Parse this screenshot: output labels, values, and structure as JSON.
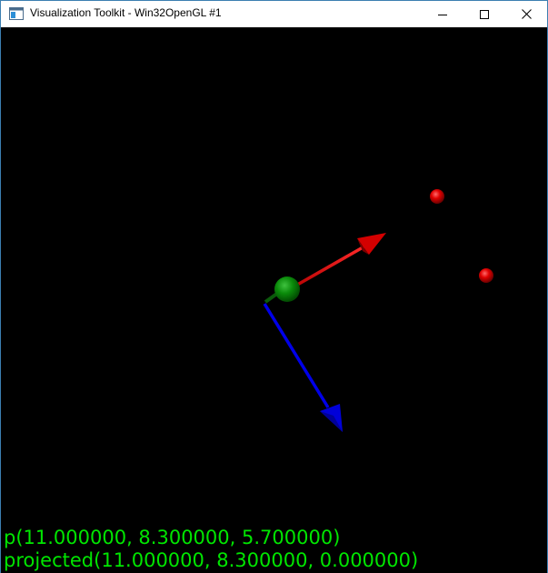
{
  "window": {
    "title": "Visualization Toolkit - Win32OpenGL #1",
    "icon": "vtk-window-icon",
    "controls": {
      "minimize_icon": "minimize-icon",
      "maximize_icon": "maximize-icon",
      "close_icon": "close-icon"
    }
  },
  "viewport": {
    "background_color": "#000000",
    "scene": {
      "origin_sphere_color": "#0a8a0a",
      "red_arrow_color": "#e00000",
      "blue_arrow_color": "#0000e8",
      "red_sphere_color": "#e00000"
    },
    "text_color": "#00e600",
    "text_lines": {
      "point": "p(11.000000, 8.300000, 5.700000)",
      "projected": "projected(11.000000, 8.300000, 0.000000)"
    }
  }
}
